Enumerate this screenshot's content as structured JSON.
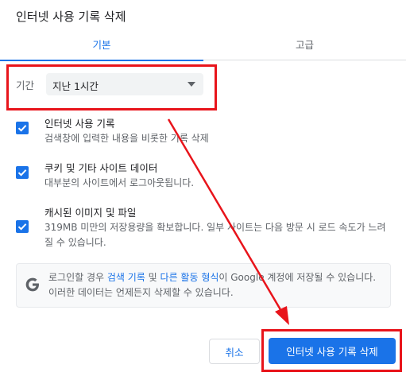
{
  "dialog": {
    "title": "인터넷 사용 기록 삭제",
    "tabs": [
      {
        "label": "기본",
        "active": true
      },
      {
        "label": "고급",
        "active": false
      }
    ],
    "time_range": {
      "label": "기간",
      "selected": "지난 1시간"
    },
    "items": [
      {
        "title": "인터넷 사용 기록",
        "description": "검색창에 입력한 내용을 비롯한 기록 삭제",
        "checked": true
      },
      {
        "title": "쿠키 및 기타 사이트 데이터",
        "description": "대부분의 사이트에서 로그아웃됩니다.",
        "checked": true
      },
      {
        "title": "캐시된 이미지 및 파일",
        "description": "319MB 미만의 저장용량을 확보합니다. 일부 사이트는 다음 방문 시 로드 속도가 느려질 수 있습니다.",
        "checked": true
      }
    ],
    "info": {
      "part1": "로그인할 경우 ",
      "link1": "검색 기록",
      "part2": " 및 ",
      "link2": "다른 활동 형식",
      "part3": "이 Google 계정에 저장될 수 있습니다. 이러한 데이터는 언제든지 삭제할 수 있습니다."
    },
    "buttons": {
      "cancel": "취소",
      "confirm": "인터넷 사용 기록 삭제"
    }
  },
  "colors": {
    "accent": "#1a73e8",
    "highlight": "#e8141b"
  },
  "icons": {
    "info": "google-g-icon",
    "dropdown": "caret-down-icon",
    "checkbox": "checkmark-icon"
  }
}
